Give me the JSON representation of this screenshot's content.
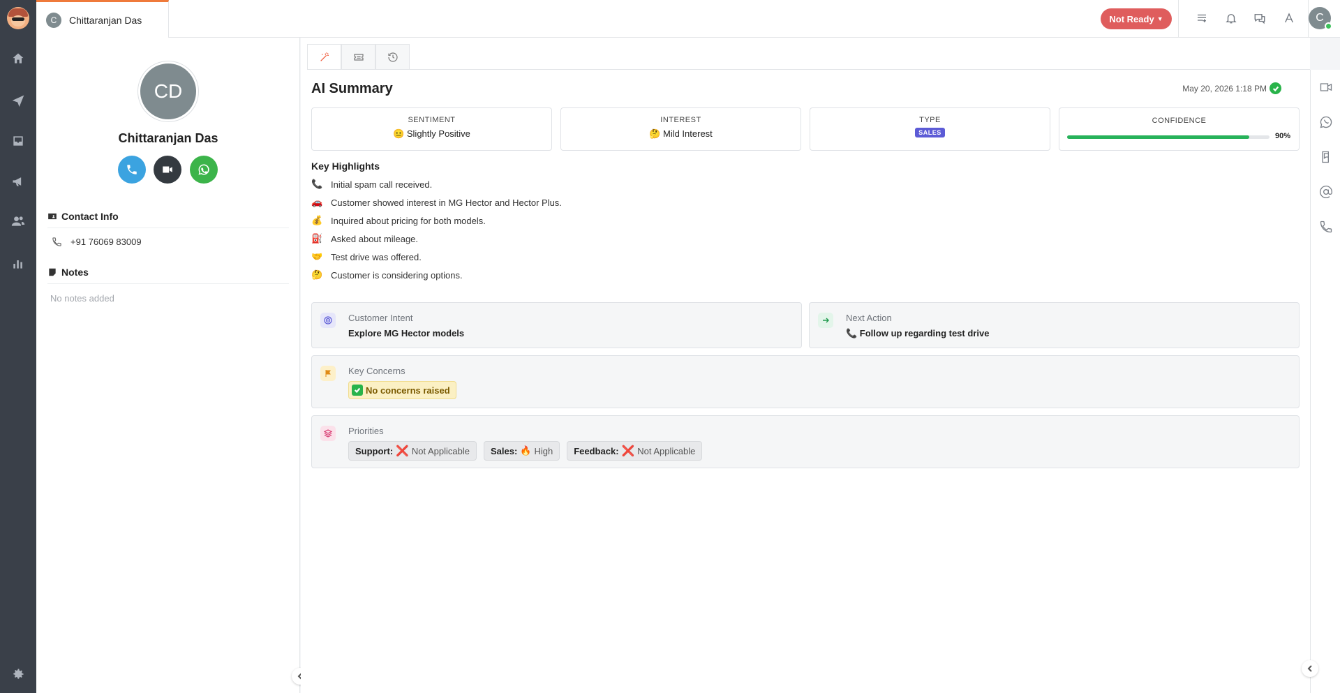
{
  "nav": {
    "items": [
      {
        "name": "home-icon"
      },
      {
        "name": "send-icon"
      },
      {
        "name": "inbox-icon"
      },
      {
        "name": "megaphone-icon"
      },
      {
        "name": "users-icon"
      },
      {
        "name": "bar-chart-icon"
      },
      {
        "name": "gear-icon"
      }
    ]
  },
  "topbar": {
    "tab_initial": "C",
    "tab_name": "Chittaranjan Das",
    "status_label": "Not Ready",
    "user_initial": "C",
    "icons": [
      "list-icon",
      "bell-icon",
      "chat-icon",
      "font-icon"
    ]
  },
  "contact": {
    "initials": "CD",
    "name": "Chittaranjan Das",
    "contact_info_title": "Contact Info",
    "phone": "+91 76069 83009",
    "notes_title": "Notes",
    "notes_empty": "No notes added",
    "colors": {
      "call": "#3ba3e0",
      "video": "#343a40",
      "whatsapp": "#3cb44a"
    }
  },
  "summary": {
    "title": "AI Summary",
    "date": "May 20, 2026 1:18 PM",
    "sentiment_label": "SENTIMENT",
    "sentiment_value": "😐 Slightly Positive",
    "interest_label": "INTEREST",
    "interest_value": "🤔 Mild Interest",
    "type_label": "TYPE",
    "type_value": "SALES",
    "confidence_label": "CONFIDENCE",
    "confidence_value": "90%",
    "confidence_fraction": 0.9,
    "highlights_title": "Key Highlights",
    "highlights": [
      {
        "emoji": "📞",
        "text": "Initial spam call received."
      },
      {
        "emoji": "🚗",
        "text": "Customer showed interest in MG Hector and Hector Plus."
      },
      {
        "emoji": "💰",
        "text": "Inquired about pricing for both models."
      },
      {
        "emoji": "⛽",
        "text": "Asked about mileage."
      },
      {
        "emoji": "🤝",
        "text": "Test drive was offered."
      },
      {
        "emoji": "🤔",
        "text": "Customer is considering options."
      }
    ],
    "intent_title": "Customer Intent",
    "intent_value": "Explore MG Hector models",
    "next_title": "Next Action",
    "next_value": "📞 Follow up regarding test drive",
    "concerns_title": "Key Concerns",
    "concerns_value": "No concerns raised",
    "priorities_title": "Priorities",
    "priorities": [
      {
        "key": "Support:",
        "icon": "❌",
        "value": "Not Applicable"
      },
      {
        "key": "Sales:",
        "icon": "🔥",
        "value": "High"
      },
      {
        "key": "Feedback:",
        "icon": "❌",
        "value": "Not Applicable"
      }
    ]
  },
  "right_rail": [
    "video-icon",
    "whatsapp-icon",
    "sms-icon",
    "email-icon",
    "phone-icon"
  ],
  "accent": "#ef7a3b"
}
